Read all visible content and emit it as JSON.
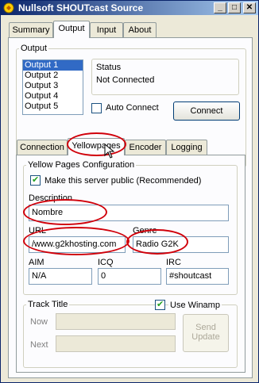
{
  "window": {
    "title": "Nullsoft SHOUTcast Source"
  },
  "main_tabs": [
    {
      "label": "Summary"
    },
    {
      "label": "Output"
    },
    {
      "label": "Input"
    },
    {
      "label": "About"
    }
  ],
  "output_group": {
    "title": "Output",
    "items": [
      "Output 1",
      "Output 2",
      "Output 3",
      "Output 4",
      "Output 5"
    ],
    "selected_item": "Output 1",
    "status_title": "Status",
    "status_text": "Not Connected",
    "auto_connect_label": "Auto Connect",
    "auto_connect_checked": false,
    "connect_label": "Connect"
  },
  "sub_tabs": [
    {
      "label": "Connection"
    },
    {
      "label": "Yellowpages"
    },
    {
      "label": "Encoder"
    },
    {
      "label": "Logging"
    }
  ],
  "active_sub_tab": "Yellowpages",
  "yp": {
    "title": "Yellow Pages Configuration",
    "public_label": "Make this server public (Recommended)",
    "public_checked": true,
    "description_label": "Description",
    "description_value": "Nombre",
    "url_label": "URL",
    "url_value": "/www.g2khosting.com",
    "genre_label": "Genre",
    "genre_value": "Radio G2K",
    "aim_label": "AIM",
    "aim_value": "N/A",
    "icq_label": "ICQ",
    "icq_value": "0",
    "irc_label": "IRC",
    "irc_value": "#shoutcast"
  },
  "track": {
    "title": "Track Title",
    "use_winamp_label": "Use Winamp",
    "use_winamp_checked": true,
    "now_label": "Now",
    "next_label": "Next",
    "send_update_line1": "Send",
    "send_update_line2": "Update"
  }
}
